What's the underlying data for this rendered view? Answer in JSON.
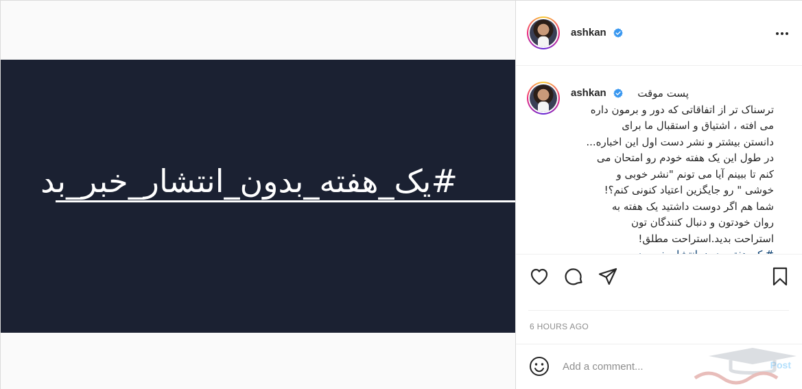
{
  "media": {
    "hashtag_text": "#یک_هفته_بدون_انتشار_خبر_بد"
  },
  "header": {
    "username": "ashkan",
    "verified": true
  },
  "caption": {
    "username": "ashkan",
    "lines": [
      "پست موقت",
      "ترسناک تر از اتفاقاتی که دور و برمون داره",
      "می افته ، اشتیاق و استقبال ما برای",
      "دانستن بیشتر و نشر دست اول این اخباره...",
      "در طول این یک هفته خودم رو امتحان می",
      "کنم تا ببینم آیا می تونم \"نشر خوبی و",
      "خوشی \" رو جایگزین اعتیاد کنونی کنم؟!",
      "شما هم اگر دوست داشتید یک هفته به",
      "روان خودتون و دنبال کنندگان تون",
      "استراحت بدید.استراحت مطلق!",
      "#یک_هفته_بدون_انتشار_خبر_بد"
    ]
  },
  "timestamp": "6 HOURS AGO",
  "comment_bar": {
    "placeholder": "Add a comment...",
    "post_label": "Post"
  },
  "colors": {
    "media_bg": "#1b2132",
    "verified": "#3897f0",
    "muted": "#8e8e8e",
    "post_disabled": "#b2dffc"
  },
  "icons": {
    "like": "heart-icon",
    "comment": "comment-bubble-icon",
    "share": "paper-plane-icon",
    "save": "bookmark-icon",
    "more": "more-options-icon",
    "emoji": "emoji-icon"
  }
}
